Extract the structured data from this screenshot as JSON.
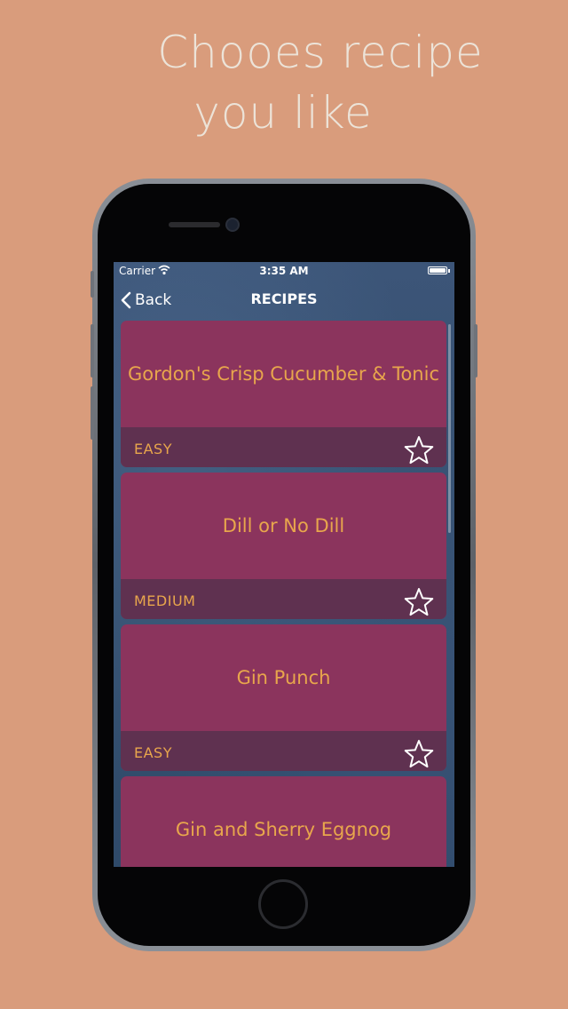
{
  "promo": {
    "headline_line1": "Chooes recipe",
    "headline_line2": "you like"
  },
  "status_bar": {
    "carrier": "Carrier",
    "time": "3:35 AM",
    "icons": [
      "wifi-icon",
      "battery-icon"
    ]
  },
  "nav": {
    "back_label": "Back",
    "title": "RECIPES",
    "back_icon": "chevron-left-icon"
  },
  "recipes": [
    {
      "name": "Gordon's Crisp Cucumber & Tonic",
      "difficulty": "EASY",
      "favorite": false
    },
    {
      "name": "Dill or No Dill",
      "difficulty": "MEDIUM",
      "favorite": false
    },
    {
      "name": "Gin Punch",
      "difficulty": "EASY",
      "favorite": false
    },
    {
      "name": "Gin and Sherry Eggnog"
    }
  ],
  "colors": {
    "background": "#d99c7c",
    "card": "#8b345d",
    "card_footer": "#5f3150",
    "accent_text": "#e8a64c"
  }
}
